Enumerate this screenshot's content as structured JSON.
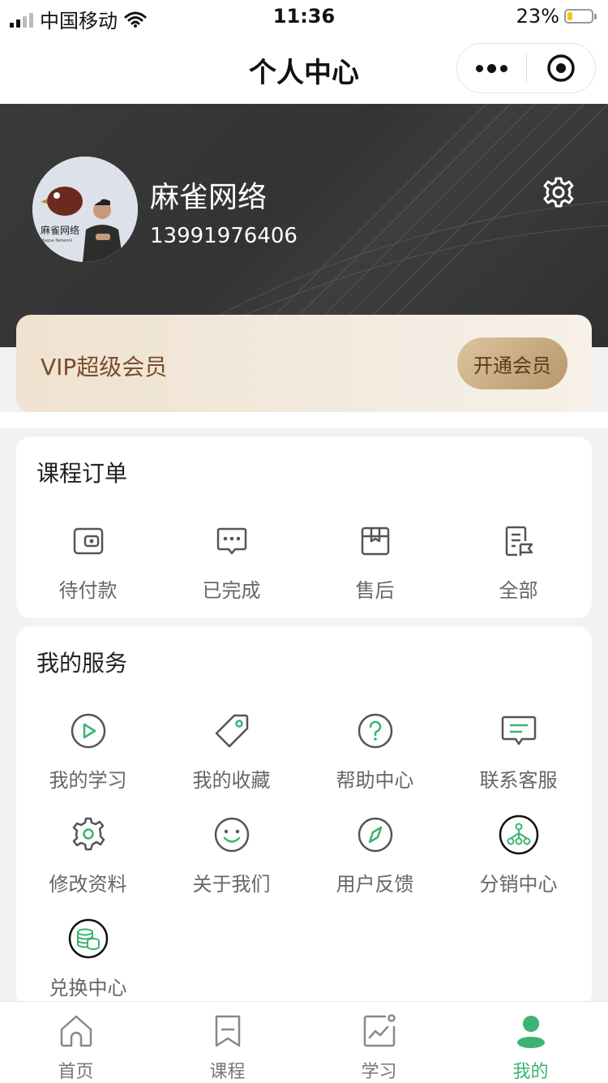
{
  "status_bar": {
    "carrier": "中国移动",
    "time": "11:36",
    "battery": "23%",
    "battery_level": 0.23
  },
  "nav": {
    "title": "个人中心"
  },
  "profile": {
    "name": "麻雀网络",
    "phone": "13991976406",
    "avatar_text": "麻雀网络",
    "avatar_subtext": "Maque Network"
  },
  "vip": {
    "title": "VIP超级会员",
    "button": "开通会员"
  },
  "orders": {
    "title": "课程订单",
    "items": [
      {
        "label": "待付款",
        "icon": "wallet-icon"
      },
      {
        "label": "已完成",
        "icon": "chat-dots-icon"
      },
      {
        "label": "售后",
        "icon": "box-icon"
      },
      {
        "label": "全部",
        "icon": "document-list-icon"
      }
    ]
  },
  "services": {
    "title": "我的服务",
    "items": [
      {
        "label": "我的学习",
        "icon": "play-circle-icon"
      },
      {
        "label": "我的收藏",
        "icon": "tag-icon"
      },
      {
        "label": "帮助中心",
        "icon": "question-circle-icon"
      },
      {
        "label": "联系客服",
        "icon": "message-icon"
      },
      {
        "label": "修改资料",
        "icon": "settings-icon"
      },
      {
        "label": "关于我们",
        "icon": "smile-icon"
      },
      {
        "label": "用户反馈",
        "icon": "compass-icon"
      },
      {
        "label": "分销中心",
        "icon": "distribution-icon"
      },
      {
        "label": "兑换中心",
        "icon": "coins-icon"
      }
    ]
  },
  "tabbar": {
    "items": [
      {
        "label": "首页",
        "icon": "home-icon",
        "active": false
      },
      {
        "label": "课程",
        "icon": "bookmark-icon",
        "active": false
      },
      {
        "label": "学习",
        "icon": "chart-icon",
        "active": false
      },
      {
        "label": "我的",
        "icon": "user-icon",
        "active": true
      }
    ]
  },
  "colors": {
    "accent": "#3cb371",
    "icon": "#555555",
    "header_bg": "#363636",
    "vip_text": "#7a4c2e"
  }
}
